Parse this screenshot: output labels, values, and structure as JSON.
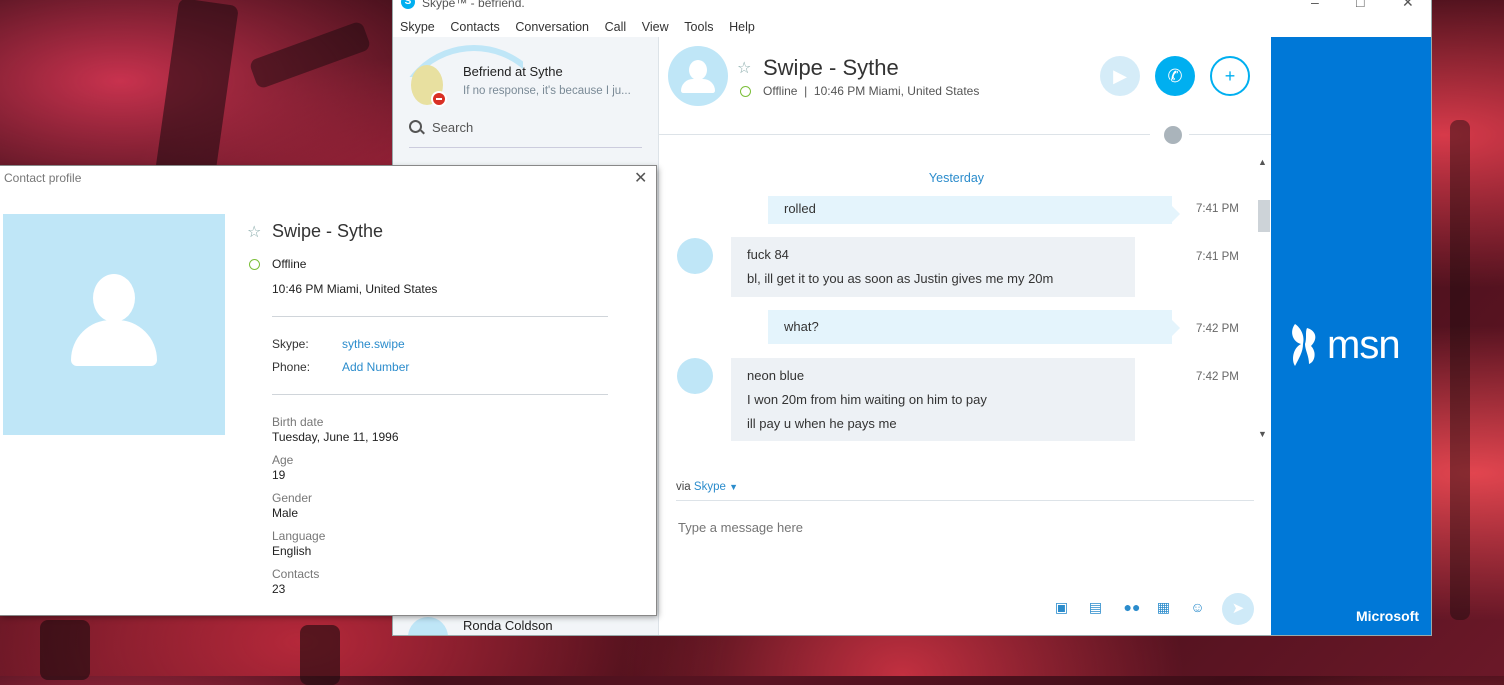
{
  "window": {
    "title": "Skype™ - befriend.",
    "menu": [
      "Skype",
      "Contacts",
      "Conversation",
      "Call",
      "View",
      "Tools",
      "Help"
    ]
  },
  "sidebar": {
    "my_name": "Befriend at Sythe",
    "my_mood": "If no response, it's because I ju...",
    "search_placeholder": "Search",
    "bottom_contact": "Ronda Coldson"
  },
  "conversation": {
    "contact_name": "Swipe - Sythe",
    "status": "Offline",
    "status_detail": "10:46 PM Miami, United States",
    "day_separator": "Yesterday",
    "messages": [
      {
        "direction": "out",
        "lines": [
          "rolled"
        ],
        "time": "7:41 PM"
      },
      {
        "direction": "in",
        "lines": [
          "fuck 84",
          "bl, ill get it to you as soon as Justin gives me my 20m"
        ],
        "time": "7:41 PM"
      },
      {
        "direction": "out",
        "lines": [
          "what?"
        ],
        "time": "7:42 PM"
      },
      {
        "direction": "in",
        "lines": [
          "neon blue",
          "I won 20m from him waiting on him to pay",
          "ill pay u when he pays me"
        ],
        "time": "7:42 PM"
      }
    ],
    "via_prefix": "via",
    "via_service": "Skype",
    "compose_placeholder": "Type a message here"
  },
  "ad": {
    "brand": "msn",
    "footer": "Microsoft",
    "color": "#0078d7"
  },
  "profile": {
    "window_title": "Contact profile",
    "name": "Swipe - Sythe",
    "status": "Offline",
    "local_time": "10:46 PM Miami, United States",
    "skype_label": "Skype:",
    "skype_id": "sythe.swipe",
    "phone_label": "Phone:",
    "phone_value": "Add Number",
    "fields": [
      {
        "key": "Birth date",
        "value": "Tuesday, June 11, 1996"
      },
      {
        "key": "Age",
        "value": "19"
      },
      {
        "key": "Gender",
        "value": "Male"
      },
      {
        "key": "Language",
        "value": "English"
      },
      {
        "key": "Contacts",
        "value": "23"
      }
    ]
  },
  "colors": {
    "accent": "#00aff0",
    "link": "#2b8ccc",
    "online_ring": "#7cbf3a",
    "avatar_bg": "#bfe6f7"
  }
}
